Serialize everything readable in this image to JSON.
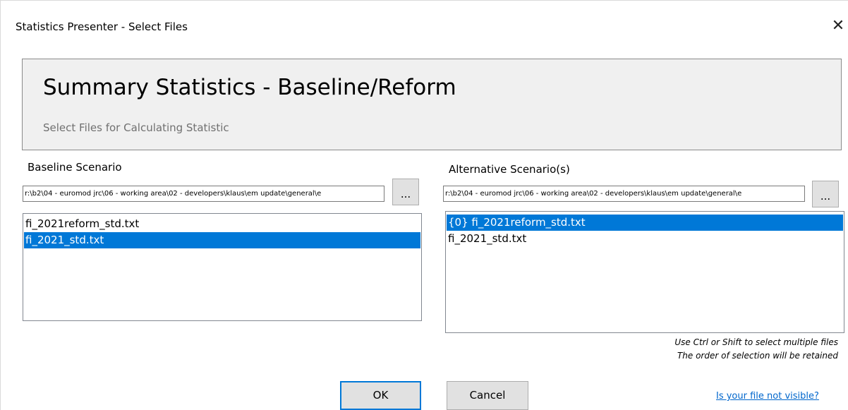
{
  "window": {
    "title": "Statistics Presenter - Select Files"
  },
  "header": {
    "title": "Summary Statistics - Baseline/Reform",
    "subtitle": "Select Files for Calculating Statistic"
  },
  "baseline": {
    "label": "Baseline Scenario",
    "path": "r:\\b2\\04 - euromod jrc\\06 - working area\\02 - developers\\klaus\\em update\\general\\e",
    "browse_label": "...",
    "files": [
      {
        "label": "fi_2021reform_std.txt",
        "selected": false
      },
      {
        "label": "fi_2021_std.txt",
        "selected": true
      }
    ]
  },
  "alternative": {
    "label": "Alternative Scenario(s)",
    "path": "r:\\b2\\04 - euromod jrc\\06 - working area\\02 - developers\\klaus\\em update\\general\\e",
    "browse_label": "...",
    "files": [
      {
        "label": "{0} fi_2021reform_std.txt",
        "selected": true
      },
      {
        "label": "fi_2021_std.txt",
        "selected": false
      }
    ]
  },
  "hints": {
    "line1": "Use Ctrl or Shift to select multiple files",
    "line2": "The order of selection will be retained"
  },
  "buttons": {
    "ok": "OK",
    "cancel": "Cancel"
  },
  "help_link": "Is your file not visible?",
  "colors": {
    "selection": "#0078d7",
    "link": "#0066cc",
    "header_bg": "#f0f0f0"
  }
}
